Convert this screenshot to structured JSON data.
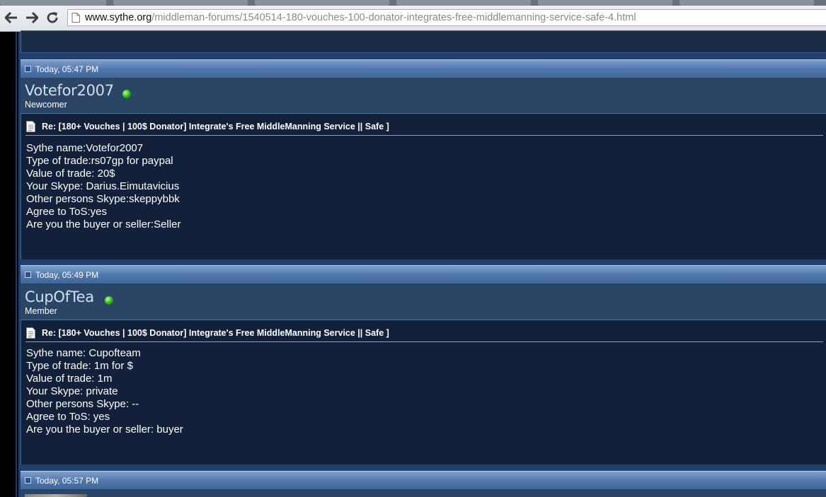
{
  "browser": {
    "url_host": "www.sythe.org",
    "url_path": "/middleman-forums/1540514-180-vouches-100-donator-integrates-free-middlemanning-service-safe-4.html"
  },
  "posts": [
    {
      "date": "Today, 05:47 PM",
      "username": "Votefor2007",
      "user_title": "Newcomer",
      "subject": "Re: [180+ Vouches | 100$ Donator] Integrate's Free MiddleManning Service || Safe ]",
      "lines": [
        "Sythe name:Votefor2007",
        "Type of trade:rs07gp for paypal",
        "Value of trade: 20$",
        "Your Skype: Darius.Eimutavicius",
        "Other persons Skype:skeppybbk",
        "Agree to ToS:yes",
        "Are you the buyer or seller:Seller"
      ]
    },
    {
      "date": "Today, 05:49 PM",
      "username": "CupOfTea",
      "user_title": "Member",
      "subject": "Re: [180+ Vouches | 100$ Donator] Integrate's Free MiddleManning Service || Safe ]",
      "lines": [
        "Sythe name: Cupofteam",
        "Type of trade: 1m for $",
        "Value of trade: 1m",
        "Your Skype: private",
        "Other persons Skype: --",
        "Agree to ToS: yes",
        "Are you the buyer or seller: buyer"
      ]
    },
    {
      "date": "Today, 05:57 PM"
    }
  ],
  "colors": {
    "date_band": "#4f76aa",
    "user_band": "#2a4566",
    "post_body": "#13203a",
    "online": "#22b214"
  }
}
